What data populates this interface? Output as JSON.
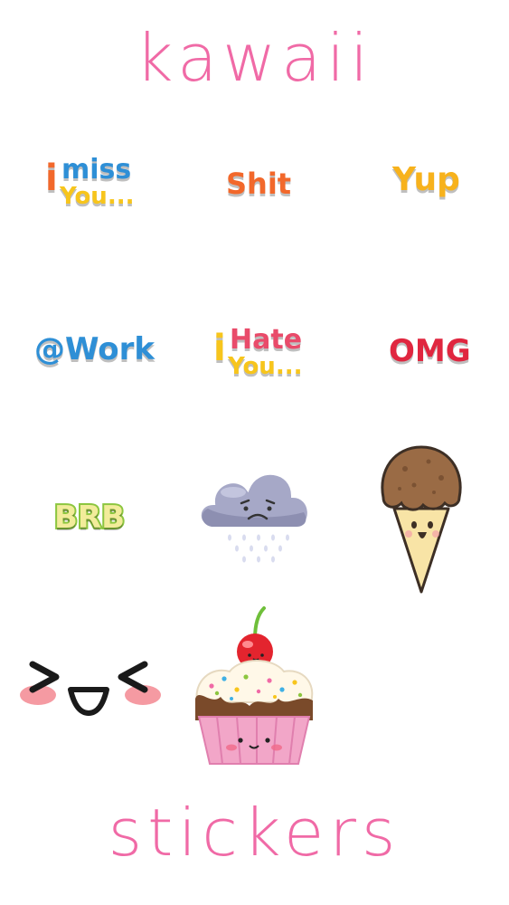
{
  "header": {
    "title": "kawaii"
  },
  "footer": {
    "title": "stickers"
  },
  "stickers": [
    {
      "name": "i miss you",
      "text_line1": "miss",
      "text_line2": "You...",
      "prefix": "i"
    },
    {
      "name": "shit",
      "text": "Shit"
    },
    {
      "name": "yup",
      "text": "Yup"
    },
    {
      "name": "at work",
      "text": "@Work"
    },
    {
      "name": "i hate you",
      "text_line1": "Hate",
      "text_line2": "You...",
      "prefix": "i"
    },
    {
      "name": "omg",
      "text": "OMG"
    },
    {
      "name": "brb",
      "text": "BRB"
    },
    {
      "name": "sad-cloud",
      "icon": "rain-cloud-icon"
    },
    {
      "name": "ice-cream",
      "icon": "ice-cream-cone-icon"
    },
    {
      "name": "happy-face",
      "icon": "kawaii-face-icon"
    },
    {
      "name": "cupcake",
      "icon": "cupcake-icon"
    }
  ],
  "colors": {
    "title_pink": "#f06aa6",
    "stroke_white": "#ffffff",
    "yellow": "#f7c51c",
    "blue": "#2e8fd6",
    "orange": "#f2682b",
    "red": "#e0263f",
    "green": "#8cc63f"
  }
}
